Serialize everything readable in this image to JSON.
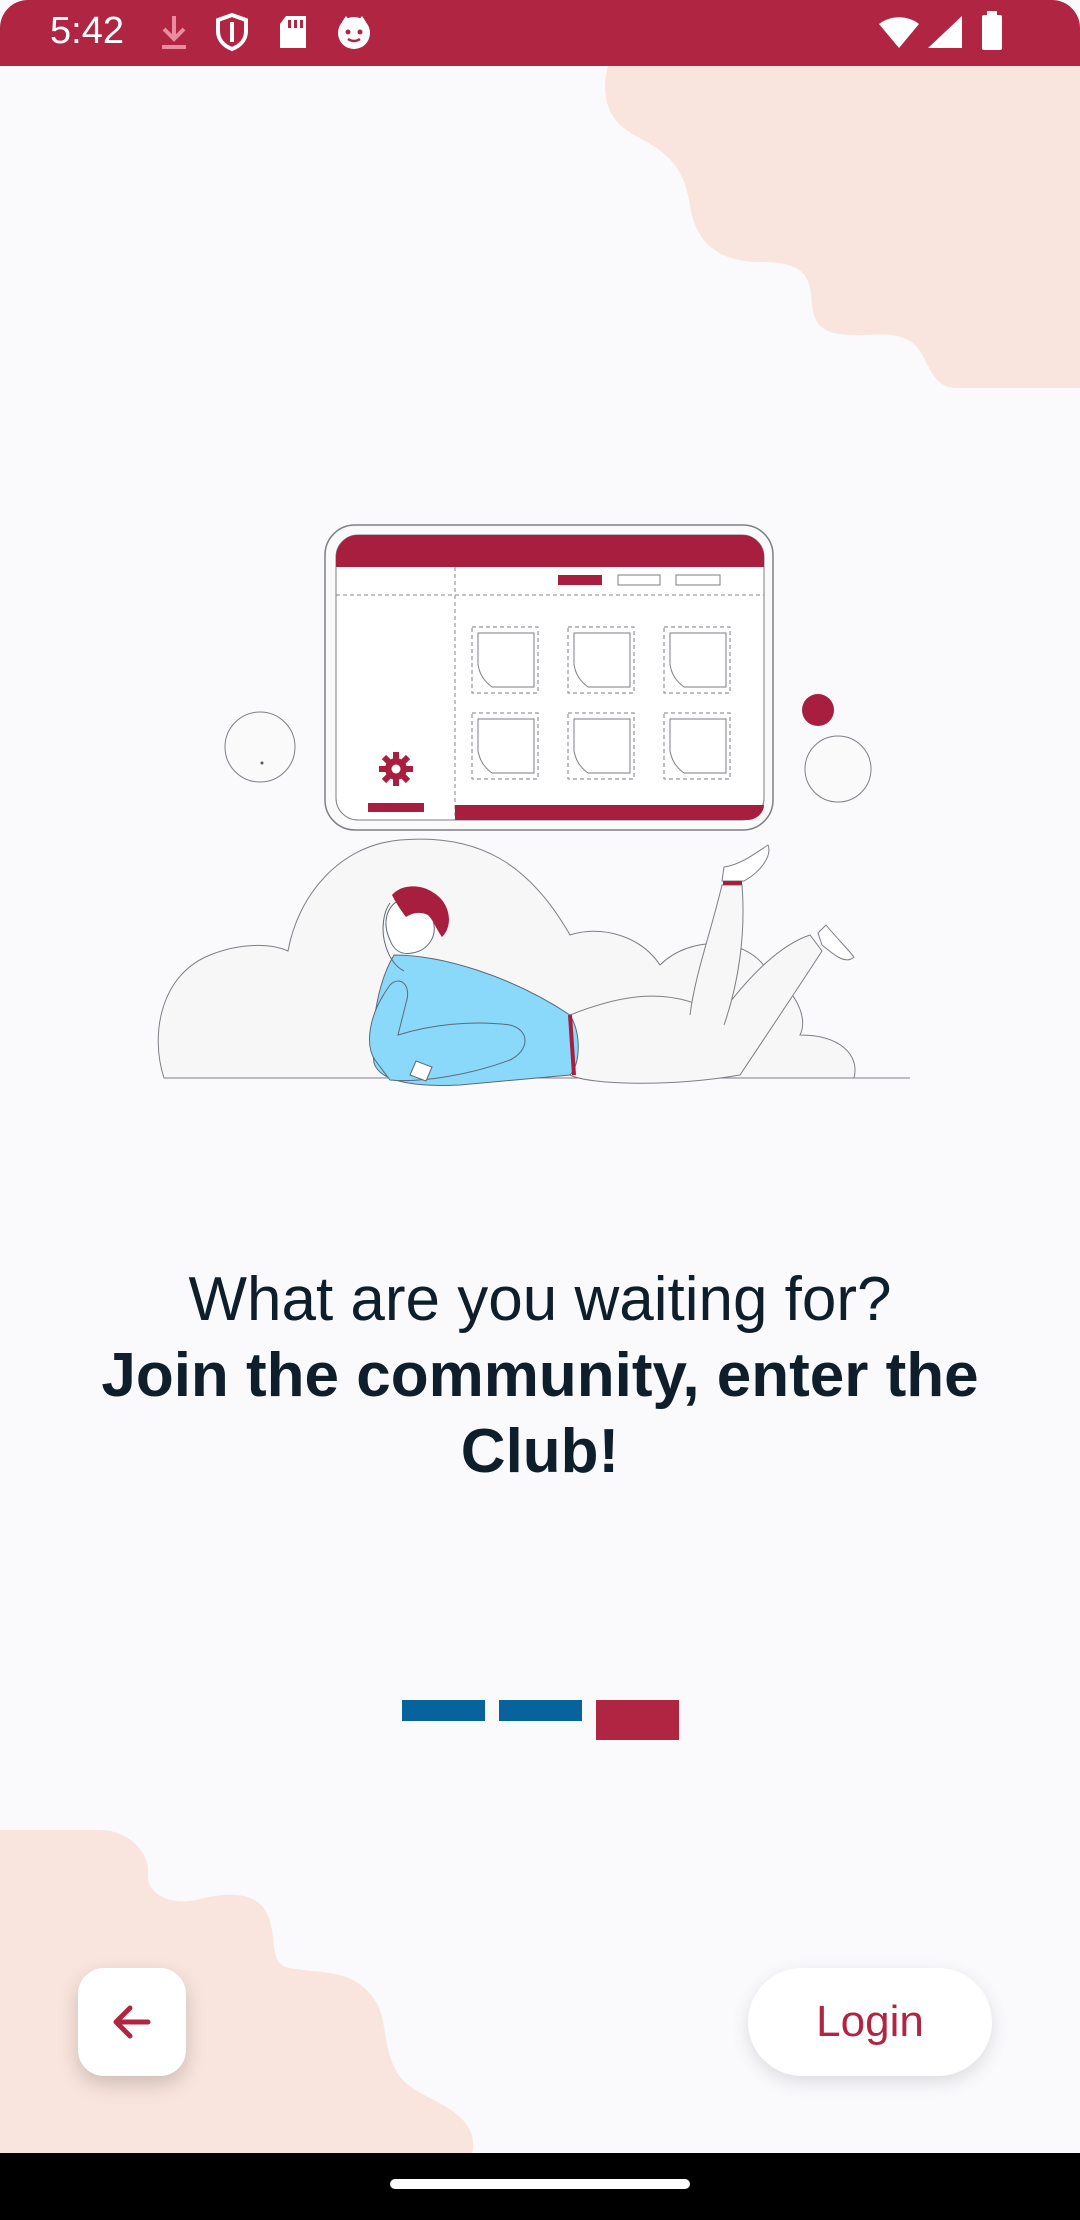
{
  "status_bar": {
    "time": "5:42",
    "icons_left": [
      "download-icon",
      "shield-icon",
      "sd-card-icon",
      "cat-icon"
    ],
    "icons_right": [
      "wifi-icon",
      "signal-icon",
      "battery-icon"
    ],
    "background": "#B02542"
  },
  "onboarding": {
    "line1": "What are you waiting for?",
    "line2": "Join the community, enter the Club!",
    "page_indicator": {
      "total": 3,
      "active_index": 2
    }
  },
  "actions": {
    "back_icon": "arrow-left-icon",
    "login_label": "Login"
  },
  "colors": {
    "accent": "#B02542",
    "indicator_inactive": "#06639E",
    "blob": "#F9E5DD",
    "text": "#0F1E2B"
  }
}
